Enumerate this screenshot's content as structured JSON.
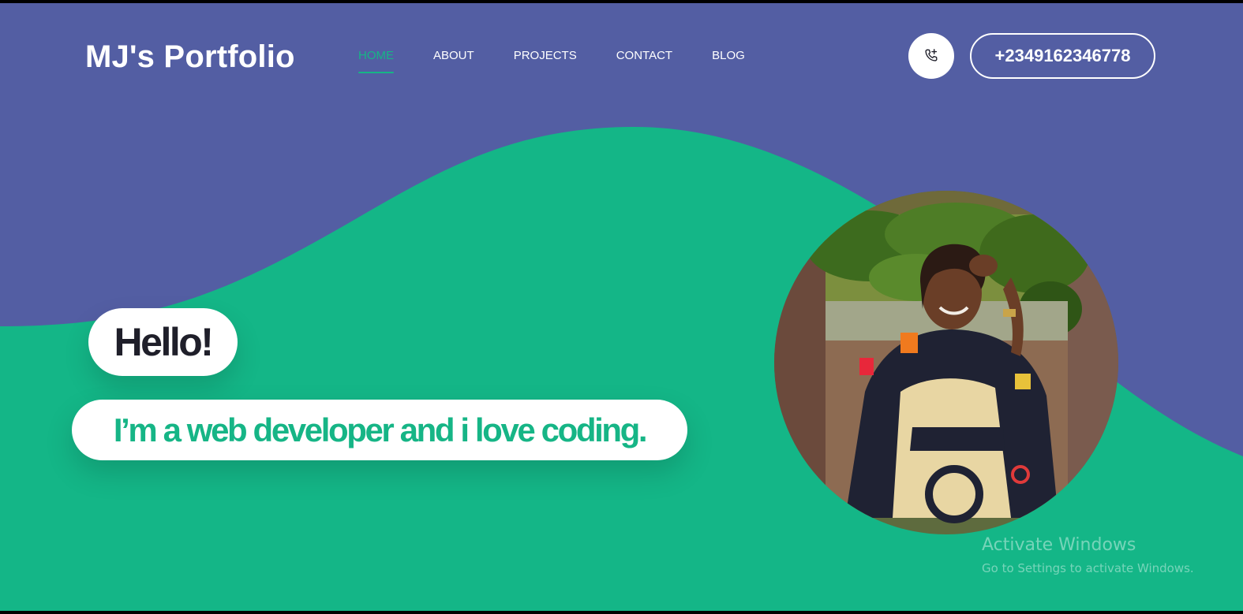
{
  "header": {
    "logo": "MJ's Portfolio",
    "nav": [
      {
        "label": "HOME",
        "active": true
      },
      {
        "label": "ABOUT",
        "active": false
      },
      {
        "label": "PROJECTS",
        "active": false
      },
      {
        "label": "CONTACT",
        "active": false
      },
      {
        "label": "BLOG",
        "active": false
      }
    ],
    "call_icon": "phone-plus-icon",
    "phone": "+2349162346778"
  },
  "hero": {
    "greeting": "Hello!",
    "tagline": "I’m a web developer and i love coding."
  },
  "watermark": {
    "title": "Activate Windows",
    "subtitle": "Go to Settings to activate Windows."
  },
  "colors": {
    "primary_purple": "#535ea3",
    "accent_green": "#16b586",
    "dark_text": "#1f1f2a",
    "white": "#ffffff"
  }
}
